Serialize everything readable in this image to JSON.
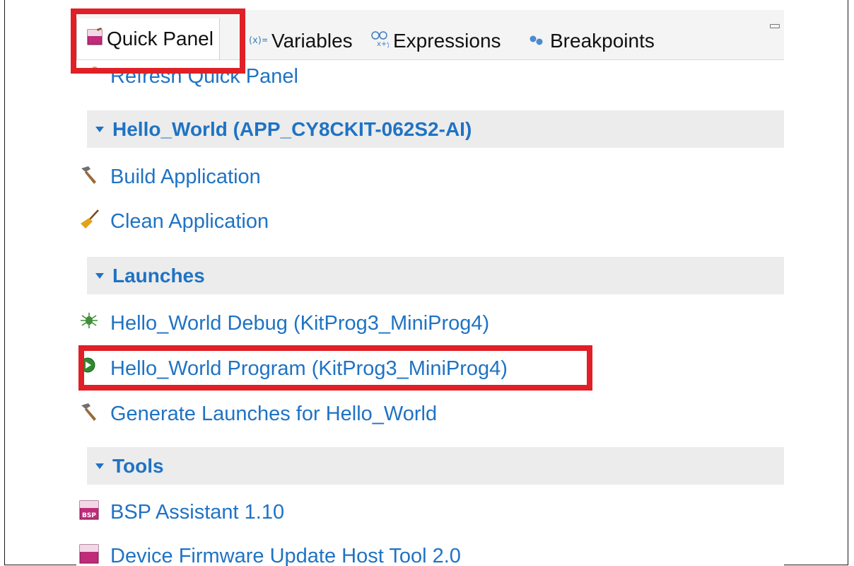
{
  "tabs": [
    {
      "label": "Quick Panel",
      "icon": "quick-panel-icon",
      "active": true
    },
    {
      "label": "Variables",
      "icon": "variables-icon"
    },
    {
      "label": "Expressions",
      "icon": "expressions-icon"
    },
    {
      "label": "Breakpoints",
      "icon": "breakpoints-icon"
    }
  ],
  "quick_panel": {
    "refresh_label": "Refresh Quick Panel",
    "sections": [
      {
        "title": "Hello_World (APP_CY8CKIT-062S2-AI)",
        "items": [
          {
            "label": "Build Application",
            "icon": "hammer-icon"
          },
          {
            "label": "Clean Application",
            "icon": "broom-icon"
          }
        ]
      },
      {
        "title": "Launches",
        "items": [
          {
            "label": "Hello_World Debug (KitProg3_MiniProg4)",
            "icon": "bug-icon"
          },
          {
            "label": "Hello_World Program (KitProg3_MiniProg4)",
            "icon": "run-icon"
          },
          {
            "label": "Generate Launches for Hello_World",
            "icon": "hammer-icon"
          }
        ]
      },
      {
        "title": "Tools",
        "items": [
          {
            "label": "BSP Assistant 1.10",
            "icon": "bsp-icon"
          },
          {
            "label": "Device Firmware Update Host Tool 2.0",
            "icon": "dfu-tool-icon"
          }
        ]
      }
    ]
  },
  "colors": {
    "link": "#1f73c4",
    "highlight": "#e01f26",
    "section_bg": "#ececec"
  }
}
